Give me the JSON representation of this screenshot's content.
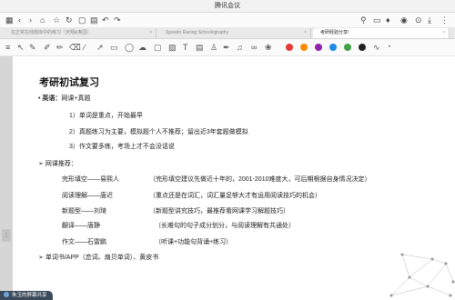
{
  "app": {
    "title": "腾讯会议"
  },
  "tabs": [
    {
      "label": "在正常在线题库中的练习（天翔&奥园）"
    },
    {
      "label": "Speedo Racing Schoolography"
    },
    {
      "label": "考研经验分享!"
    }
  ],
  "colors": {
    "red": "#e53935",
    "orange": "#fb8c00",
    "purple": "#8e24aa",
    "blue": "#1e88e5",
    "green": "#43a047",
    "black": "#222222"
  },
  "doc": {
    "title": "考研初试复习",
    "english_label": "英语：",
    "english_text": "网课+真题",
    "points": [
      "1）单词是重点，开始最早",
      "2）真题练习为主要，模拟题个人不推荐；留出近3年套题做模拟",
      "3）作文要多练，考场上才不会没话说"
    ],
    "course_header": "网课推荐：",
    "courses": [
      {
        "name": "完形填空——易熙人",
        "note": "（完形填空建议先做近十年的，2001-2010难度大，可后期根据自身情况决定）"
      },
      {
        "name": "阅读理解——唐迟",
        "note": "（重点还是在词汇，词汇量足够大才有运用阅读技巧的机会）"
      },
      {
        "name": "新题型——刘琦",
        "note": "（新题型讲究技巧，最推荐看网课学习解题技巧）"
      },
      {
        "name": "翻译——唐静",
        "note": "（长难句的句子成分划分，与阅读理解有共通处）"
      },
      {
        "name": "作文——石雷鹏",
        "note": "（听课+功能句背诵+练习）"
      }
    ],
    "apps": "单词书/APP（恋词、扇贝单词）、黄皮书"
  },
  "share": {
    "label": "朱玉的屏幕共享"
  }
}
